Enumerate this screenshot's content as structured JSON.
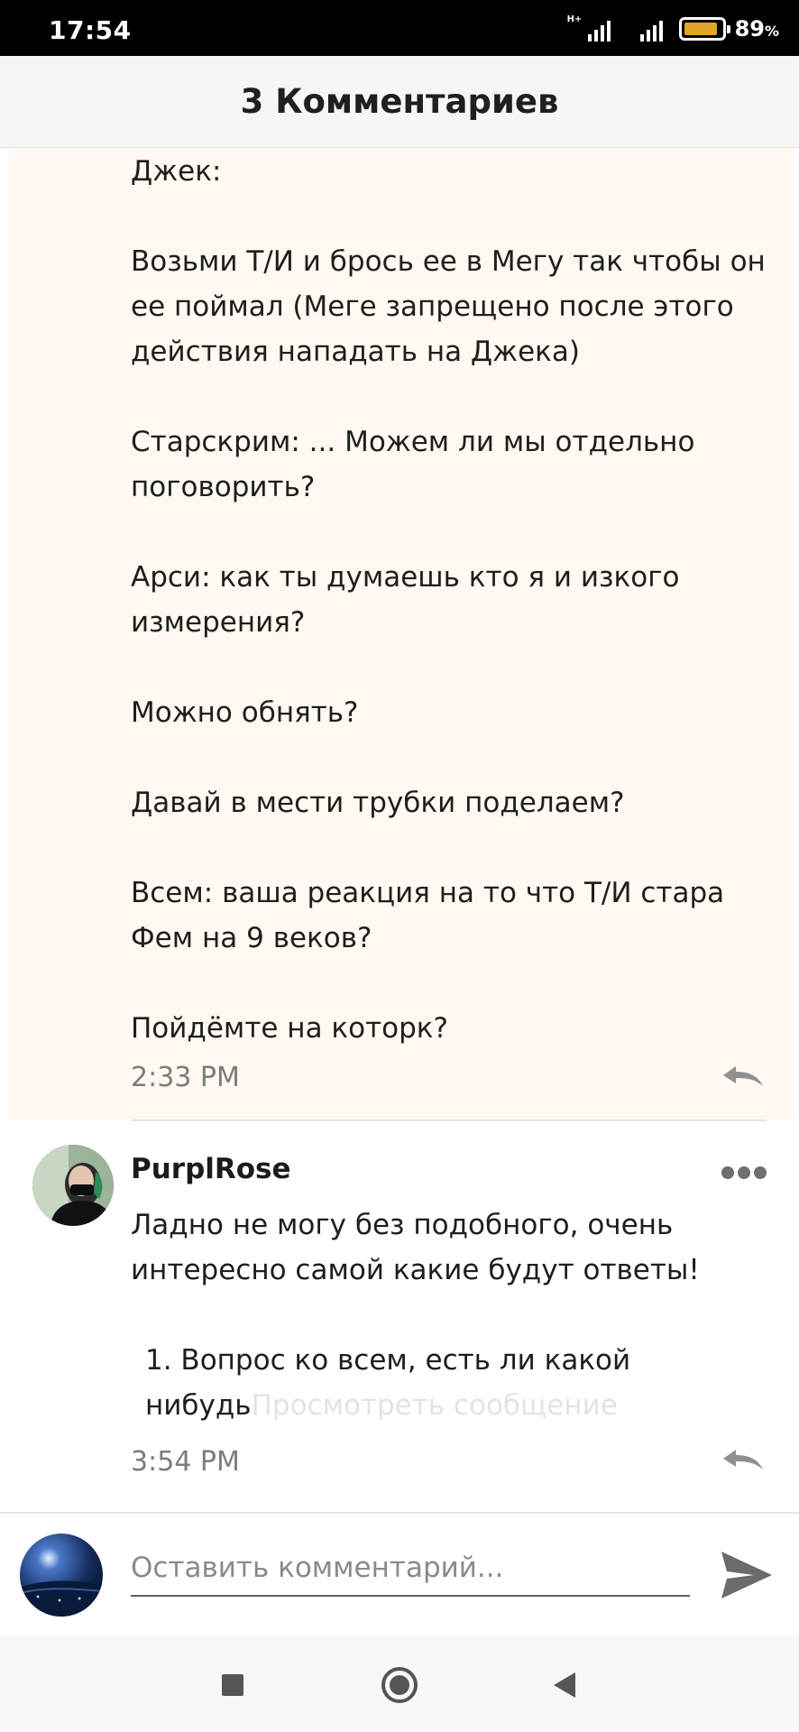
{
  "status_bar": {
    "time": "17:54",
    "network_tag": "H+",
    "battery_percent": "89",
    "battery_unit": "%",
    "battery_level": 0.89,
    "battery_color": "#e2a52b",
    "icons": [
      "signal-icon",
      "signal-icon",
      "battery-icon"
    ]
  },
  "header": {
    "title": "3 Комментариев"
  },
  "comments": [
    {
      "paragraphs": [
        "Джек:",
        "Возьми Т/И и брось ее в Мегу так чтобы он ее поймал (Меге запрещено после этого действия нападать на Джека)",
        "Старскрим: ... Можем ли мы отдельно поговорить?",
        "Арси: как ты думаешь кто я и изкого измерения?",
        "Можно обнять?",
        "Давай в мести трубки поделаем?",
        "Всем: ваша реакция на то что Т/И стара Фем на 9 веков?",
        "Пойдёмте на которк?"
      ],
      "time": "2:33 PM",
      "highlight_color": "#fff9f1",
      "reply_icon": "reply-icon"
    },
    {
      "author": "PurplRose",
      "paragraphs": [
        "Ладно не могу без подобного, очень интересно самой какие будут ответы!"
      ],
      "list_item": "1. Вопрос ко всем, есть ли какой нибудь",
      "view_message": "Просмотреть сообщение",
      "time": "3:54 PM",
      "more_icon": "more-dots-icon",
      "reply_icon": "reply-icon"
    }
  ],
  "input": {
    "placeholder": "Оставить комментарий...",
    "value": "",
    "send_icon": "send-icon"
  },
  "nav": {
    "icons": [
      "recents-square-icon",
      "home-circle-icon",
      "back-triangle-icon"
    ]
  }
}
